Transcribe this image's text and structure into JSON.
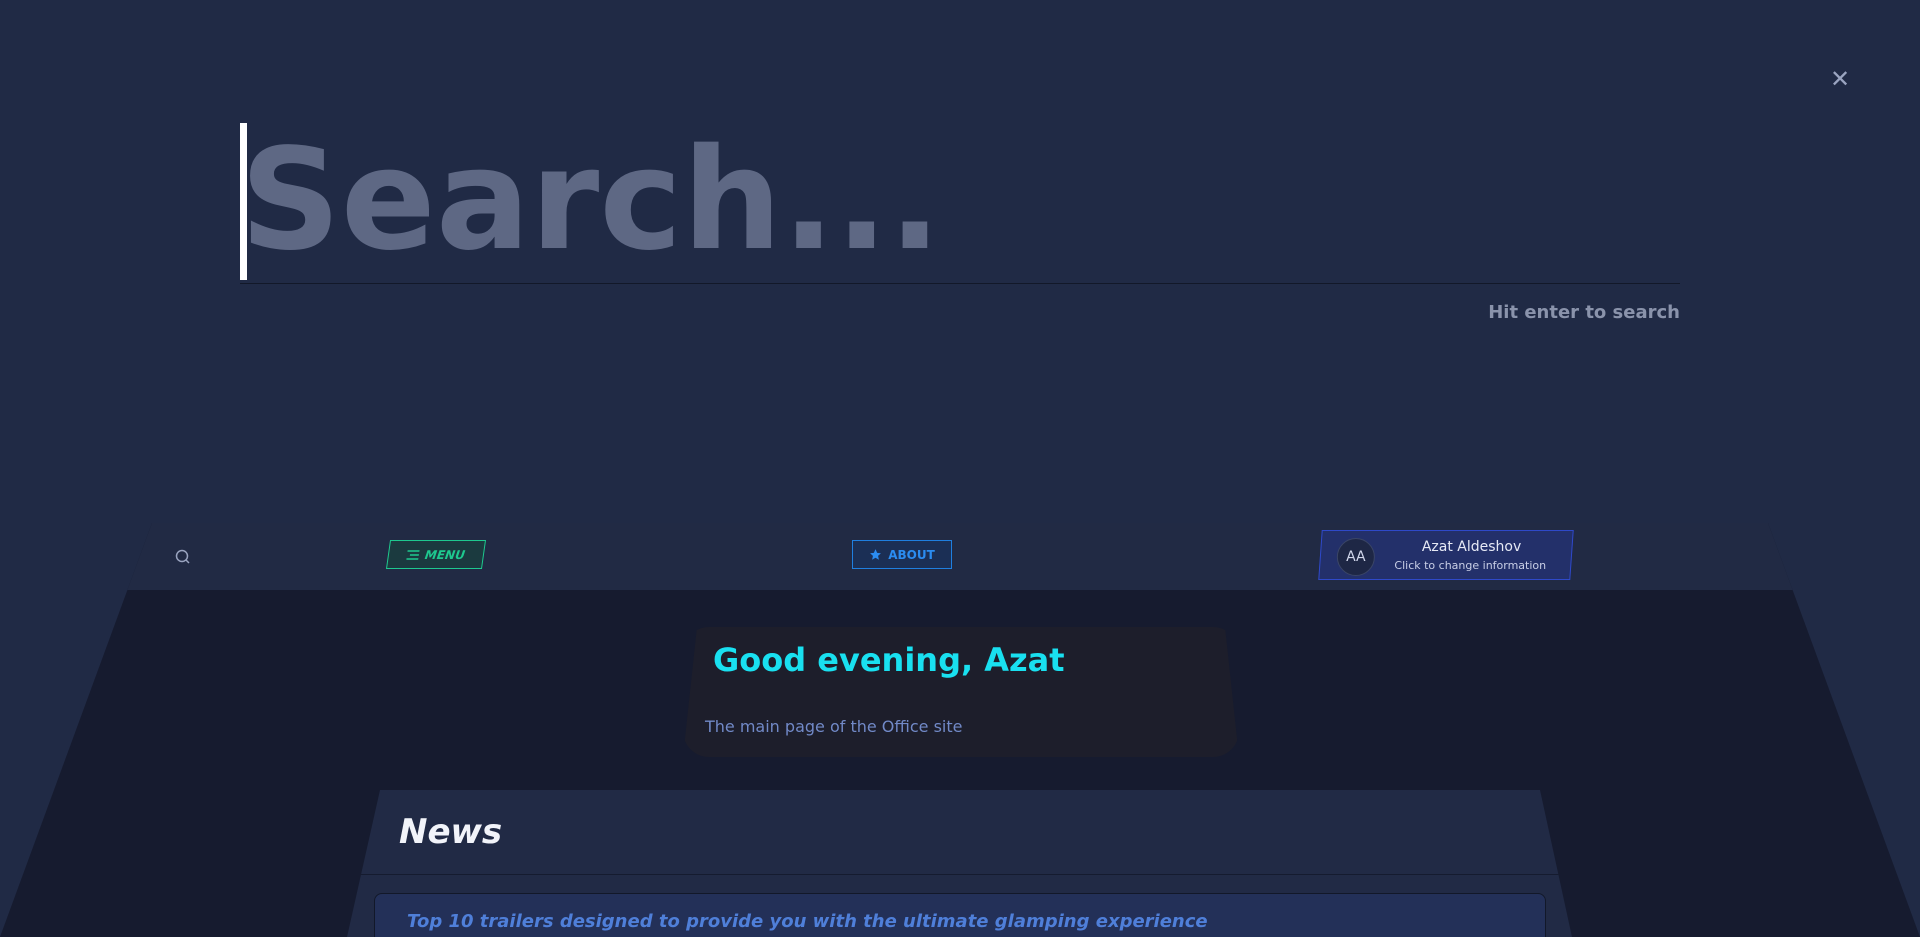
{
  "search": {
    "placeholder": "Search...",
    "hint": "Hit enter to search"
  },
  "navbar": {
    "menu_label": "MENU",
    "about_label": "ABOUT",
    "user": {
      "initials": "AA",
      "name": "Azat Aldeshov",
      "subtitle": "Click to change information"
    }
  },
  "greeting": {
    "title": "Good evening, Azat",
    "subtitle": "The main page of the Office site"
  },
  "news": {
    "heading": "News",
    "items": [
      {
        "title": "Top 10 trailers designed to provide you with the ultimate glamping experience"
      }
    ]
  },
  "colors": {
    "background": "#202a45",
    "accent_cyan": "#19e0f0",
    "menu_green": "#1ec98f",
    "about_blue": "#2b8cf0"
  }
}
